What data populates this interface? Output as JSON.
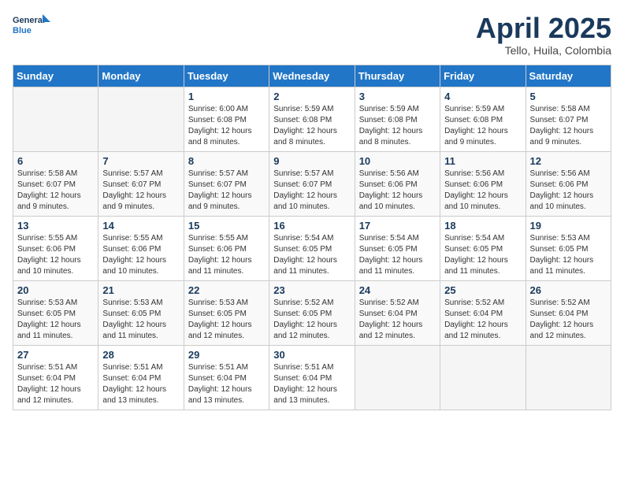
{
  "header": {
    "logo_line1": "General",
    "logo_line2": "Blue",
    "month_title": "April 2025",
    "subtitle": "Tello, Huila, Colombia"
  },
  "weekdays": [
    "Sunday",
    "Monday",
    "Tuesday",
    "Wednesday",
    "Thursday",
    "Friday",
    "Saturday"
  ],
  "weeks": [
    [
      {
        "day": "",
        "info": ""
      },
      {
        "day": "",
        "info": ""
      },
      {
        "day": "1",
        "info": "Sunrise: 6:00 AM\nSunset: 6:08 PM\nDaylight: 12 hours\nand 8 minutes."
      },
      {
        "day": "2",
        "info": "Sunrise: 5:59 AM\nSunset: 6:08 PM\nDaylight: 12 hours\nand 8 minutes."
      },
      {
        "day": "3",
        "info": "Sunrise: 5:59 AM\nSunset: 6:08 PM\nDaylight: 12 hours\nand 8 minutes."
      },
      {
        "day": "4",
        "info": "Sunrise: 5:59 AM\nSunset: 6:08 PM\nDaylight: 12 hours\nand 9 minutes."
      },
      {
        "day": "5",
        "info": "Sunrise: 5:58 AM\nSunset: 6:07 PM\nDaylight: 12 hours\nand 9 minutes."
      }
    ],
    [
      {
        "day": "6",
        "info": "Sunrise: 5:58 AM\nSunset: 6:07 PM\nDaylight: 12 hours\nand 9 minutes."
      },
      {
        "day": "7",
        "info": "Sunrise: 5:57 AM\nSunset: 6:07 PM\nDaylight: 12 hours\nand 9 minutes."
      },
      {
        "day": "8",
        "info": "Sunrise: 5:57 AM\nSunset: 6:07 PM\nDaylight: 12 hours\nand 9 minutes."
      },
      {
        "day": "9",
        "info": "Sunrise: 5:57 AM\nSunset: 6:07 PM\nDaylight: 12 hours\nand 10 minutes."
      },
      {
        "day": "10",
        "info": "Sunrise: 5:56 AM\nSunset: 6:06 PM\nDaylight: 12 hours\nand 10 minutes."
      },
      {
        "day": "11",
        "info": "Sunrise: 5:56 AM\nSunset: 6:06 PM\nDaylight: 12 hours\nand 10 minutes."
      },
      {
        "day": "12",
        "info": "Sunrise: 5:56 AM\nSunset: 6:06 PM\nDaylight: 12 hours\nand 10 minutes."
      }
    ],
    [
      {
        "day": "13",
        "info": "Sunrise: 5:55 AM\nSunset: 6:06 PM\nDaylight: 12 hours\nand 10 minutes."
      },
      {
        "day": "14",
        "info": "Sunrise: 5:55 AM\nSunset: 6:06 PM\nDaylight: 12 hours\nand 10 minutes."
      },
      {
        "day": "15",
        "info": "Sunrise: 5:55 AM\nSunset: 6:06 PM\nDaylight: 12 hours\nand 11 minutes."
      },
      {
        "day": "16",
        "info": "Sunrise: 5:54 AM\nSunset: 6:05 PM\nDaylight: 12 hours\nand 11 minutes."
      },
      {
        "day": "17",
        "info": "Sunrise: 5:54 AM\nSunset: 6:05 PM\nDaylight: 12 hours\nand 11 minutes."
      },
      {
        "day": "18",
        "info": "Sunrise: 5:54 AM\nSunset: 6:05 PM\nDaylight: 12 hours\nand 11 minutes."
      },
      {
        "day": "19",
        "info": "Sunrise: 5:53 AM\nSunset: 6:05 PM\nDaylight: 12 hours\nand 11 minutes."
      }
    ],
    [
      {
        "day": "20",
        "info": "Sunrise: 5:53 AM\nSunset: 6:05 PM\nDaylight: 12 hours\nand 11 minutes."
      },
      {
        "day": "21",
        "info": "Sunrise: 5:53 AM\nSunset: 6:05 PM\nDaylight: 12 hours\nand 11 minutes."
      },
      {
        "day": "22",
        "info": "Sunrise: 5:53 AM\nSunset: 6:05 PM\nDaylight: 12 hours\nand 12 minutes."
      },
      {
        "day": "23",
        "info": "Sunrise: 5:52 AM\nSunset: 6:05 PM\nDaylight: 12 hours\nand 12 minutes."
      },
      {
        "day": "24",
        "info": "Sunrise: 5:52 AM\nSunset: 6:04 PM\nDaylight: 12 hours\nand 12 minutes."
      },
      {
        "day": "25",
        "info": "Sunrise: 5:52 AM\nSunset: 6:04 PM\nDaylight: 12 hours\nand 12 minutes."
      },
      {
        "day": "26",
        "info": "Sunrise: 5:52 AM\nSunset: 6:04 PM\nDaylight: 12 hours\nand 12 minutes."
      }
    ],
    [
      {
        "day": "27",
        "info": "Sunrise: 5:51 AM\nSunset: 6:04 PM\nDaylight: 12 hours\nand 12 minutes."
      },
      {
        "day": "28",
        "info": "Sunrise: 5:51 AM\nSunset: 6:04 PM\nDaylight: 12 hours\nand 13 minutes."
      },
      {
        "day": "29",
        "info": "Sunrise: 5:51 AM\nSunset: 6:04 PM\nDaylight: 12 hours\nand 13 minutes."
      },
      {
        "day": "30",
        "info": "Sunrise: 5:51 AM\nSunset: 6:04 PM\nDaylight: 12 hours\nand 13 minutes."
      },
      {
        "day": "",
        "info": ""
      },
      {
        "day": "",
        "info": ""
      },
      {
        "day": "",
        "info": ""
      }
    ]
  ]
}
